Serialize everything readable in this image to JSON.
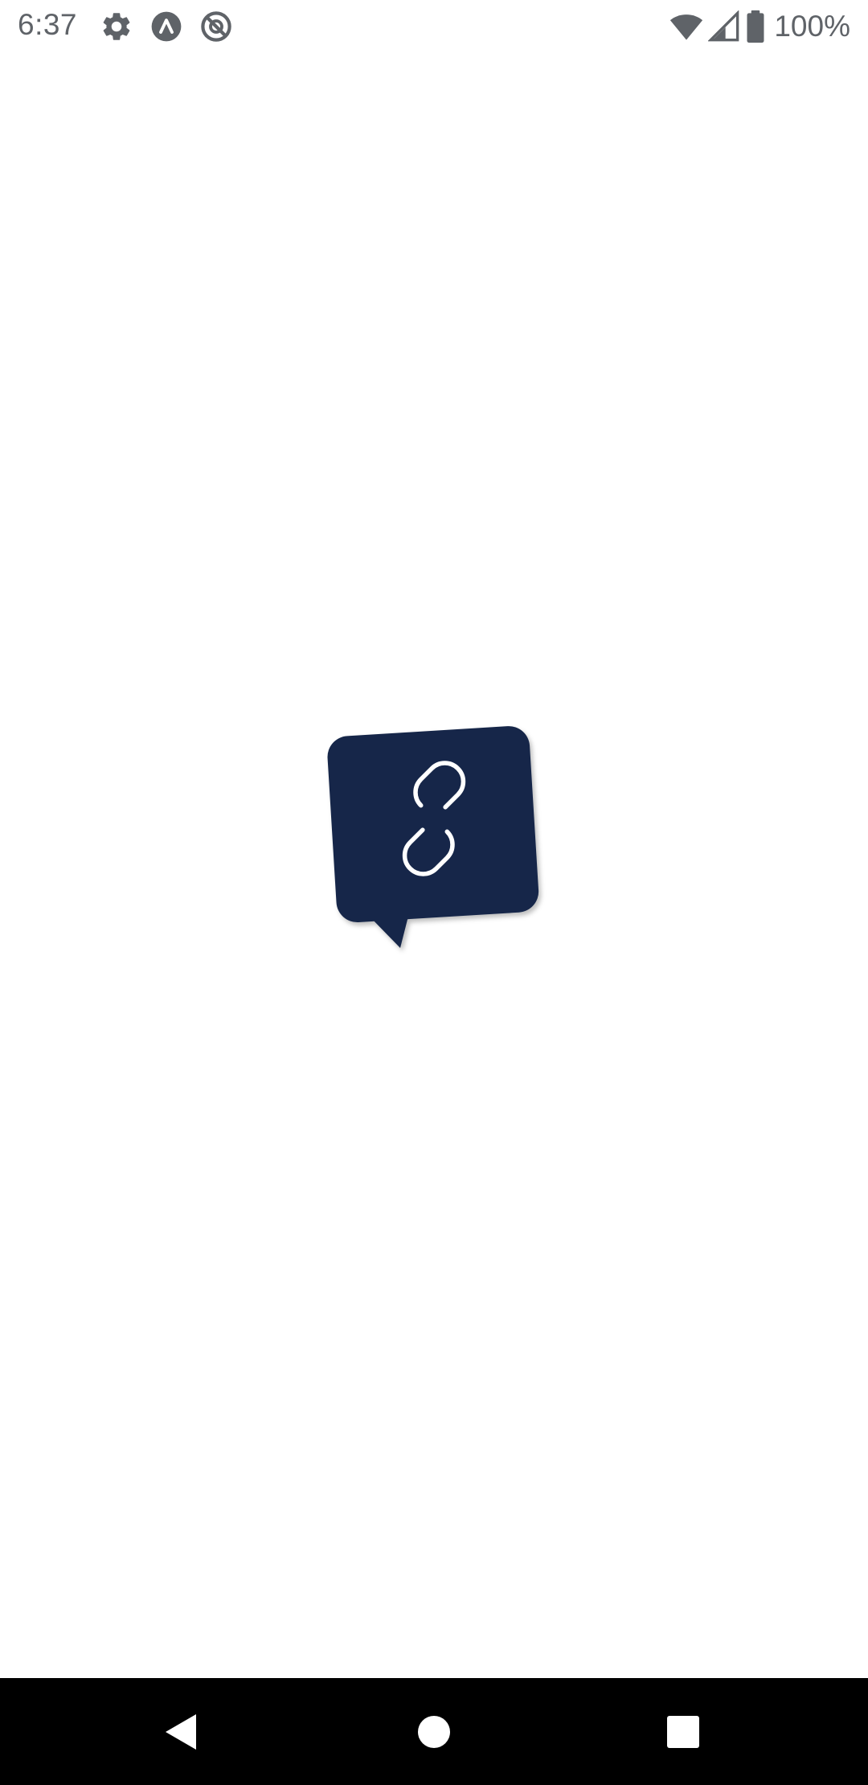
{
  "status_bar": {
    "time": "6:37",
    "left_icons": [
      "settings-icon",
      "app-logo-icon",
      "do-not-disturb-icon"
    ],
    "right_icons": [
      "wifi-icon",
      "cellular-signal-icon",
      "battery-icon"
    ],
    "battery_percent": "100%",
    "icon_color": "#5f6368"
  },
  "splash": {
    "logo_icon": "link-chat-bubble-icon",
    "logo_color": "#172849",
    "logo_glyph_color": "#ffffff"
  },
  "nav_bar": {
    "buttons": [
      "back-icon",
      "home-icon",
      "recents-icon"
    ],
    "background": "#000000",
    "icon_color": "#ffffff"
  }
}
